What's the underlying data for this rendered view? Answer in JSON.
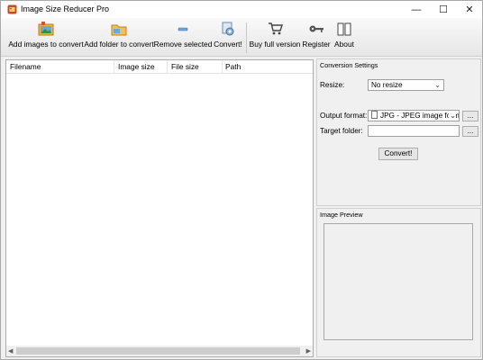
{
  "window": {
    "title": "Image Size Reducer Pro",
    "controls": {
      "minimize": "—",
      "maximize": "☐",
      "close": "✕"
    }
  },
  "toolbar": {
    "buttons": [
      {
        "label": "Add images to convert",
        "icon": "add-images-icon"
      },
      {
        "label": "Add folder to convert",
        "icon": "add-folder-icon"
      },
      {
        "label": "Remove selected",
        "icon": "remove-icon"
      },
      {
        "label": "Convert!",
        "icon": "convert-icon"
      },
      {
        "label": "Buy full version",
        "icon": "cart-icon"
      },
      {
        "label": "Register",
        "icon": "key-icon"
      },
      {
        "label": "About",
        "icon": "book-icon"
      }
    ]
  },
  "file_list": {
    "columns": [
      "Filename",
      "Image size",
      "File size",
      "Path"
    ],
    "rows": []
  },
  "settings": {
    "title": "Conversion Settings",
    "resize_label": "Resize:",
    "resize_value": "No resize",
    "output_format_label": "Output format:",
    "output_format_value": "JPG - JPEG image form",
    "target_folder_label": "Target folder:",
    "target_folder_value": "",
    "browse_label": "...",
    "convert_label": "Convert!"
  },
  "preview": {
    "title": "Image Preview"
  },
  "colors": {
    "window_bg": "#f0f0f0",
    "toolbar_top": "#fafafa",
    "toolbar_bottom": "#e6e6e6",
    "border": "#adadad"
  }
}
